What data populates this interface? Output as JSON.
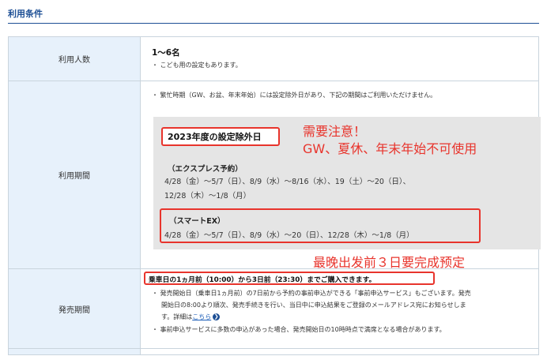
{
  "section_title": "利用条件",
  "rows": {
    "people": {
      "label": "利用人数",
      "value": "1〜6名",
      "note": "・ こども用の設定もあります。"
    },
    "period": {
      "label": "利用期間",
      "note": "・ 繁忙時期（GW、お盆、年末年始）には設定除外日があり、下記の期間はご利用いただけません。",
      "box_title": "2023年度の設定除外日",
      "annotation_line1": "需要注意！",
      "annotation_line2": "GW、夏休、年末年始不可使用",
      "express_heading": "（エクスプレス予約）",
      "express_line1": "4/28（金）〜5/7（日）、8/9（水）〜8/16（水）、19（土）〜20（日）、",
      "express_line2": "12/28（木）〜1/8（月）",
      "smart_heading": "（スマートEX）",
      "smart_line": "4/28（金）〜5/7（日）、8/9（水）〜20（日）、12/28（木）〜1/8（月）",
      "annotation_bottom": "最晚出发前３日要完成预定"
    },
    "sales": {
      "label": "発売期間",
      "highlight": "乗車日の1ヵ月前（10:00）から3日前（23:30）までご購入できます。",
      "note1_line1": "・ 発売開始日（乗車日1ヵ月前）の7日前から予約の事前申込ができる「事前申込サービス」もございます。発売",
      "note1_line2": "開始日の8:00より順次、発売手続きを行い、当日中に申込結果をご登録のメールアドレス宛にお知らせしま",
      "note1_line3_prefix": "す。詳細は",
      "link_text": "こちら",
      "note2": "・ 事前申込サービスに多数の申込があった場合、発売開始日の10時時点で満席となる場合があります。"
    }
  }
}
